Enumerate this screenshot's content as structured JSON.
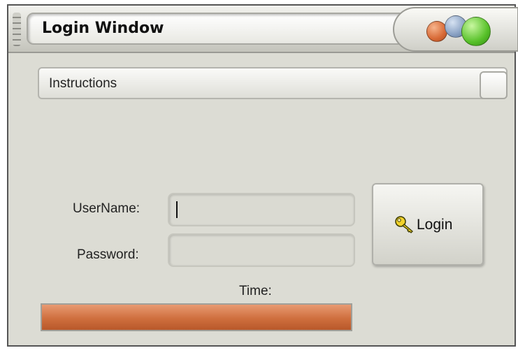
{
  "window": {
    "title": "Login Window"
  },
  "instructions": {
    "label": "Instructions"
  },
  "form": {
    "username_label": "UserName:",
    "username_value": "",
    "password_label": "Password:",
    "password_value": "",
    "login_label": "Login"
  },
  "time": {
    "label": "Time:",
    "progress_fraction": 1.0
  },
  "icons": {
    "title_buttons": [
      "orange-ball-icon",
      "blue-ball-icon",
      "green-ball-icon"
    ],
    "login": "key-icon"
  },
  "colors": {
    "progress": "#cf6f3e",
    "ball_orange": "#d86a36",
    "ball_blue": "#8aa2c4",
    "ball_green": "#58c12a"
  }
}
